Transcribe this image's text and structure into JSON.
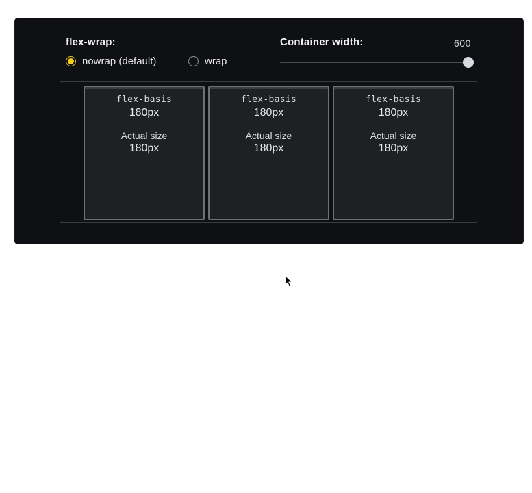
{
  "flex_wrap": {
    "label": "flex-wrap:",
    "options": [
      {
        "label": "nowrap (default)",
        "checked": true
      },
      {
        "label": "wrap",
        "checked": false
      }
    ]
  },
  "container_width": {
    "label": "Container width:",
    "value": "600",
    "slider_level": 1.0
  },
  "items": [
    {
      "basis_label": "flex-basis",
      "basis_value": "180px",
      "actual_label": "Actual size",
      "actual_value": "180px"
    },
    {
      "basis_label": "flex-basis",
      "basis_value": "180px",
      "actual_label": "Actual size",
      "actual_value": "180px"
    },
    {
      "basis_label": "flex-basis",
      "basis_value": "180px",
      "actual_label": "Actual size",
      "actual_value": "180px"
    }
  ],
  "colors": {
    "panel_bg": "#0f1013",
    "accent": "#f3cc1b",
    "item_bg": "#1e2023",
    "item_border": "#6d7075"
  },
  "icons": {
    "cursor": "mouse-pointer-icon"
  }
}
